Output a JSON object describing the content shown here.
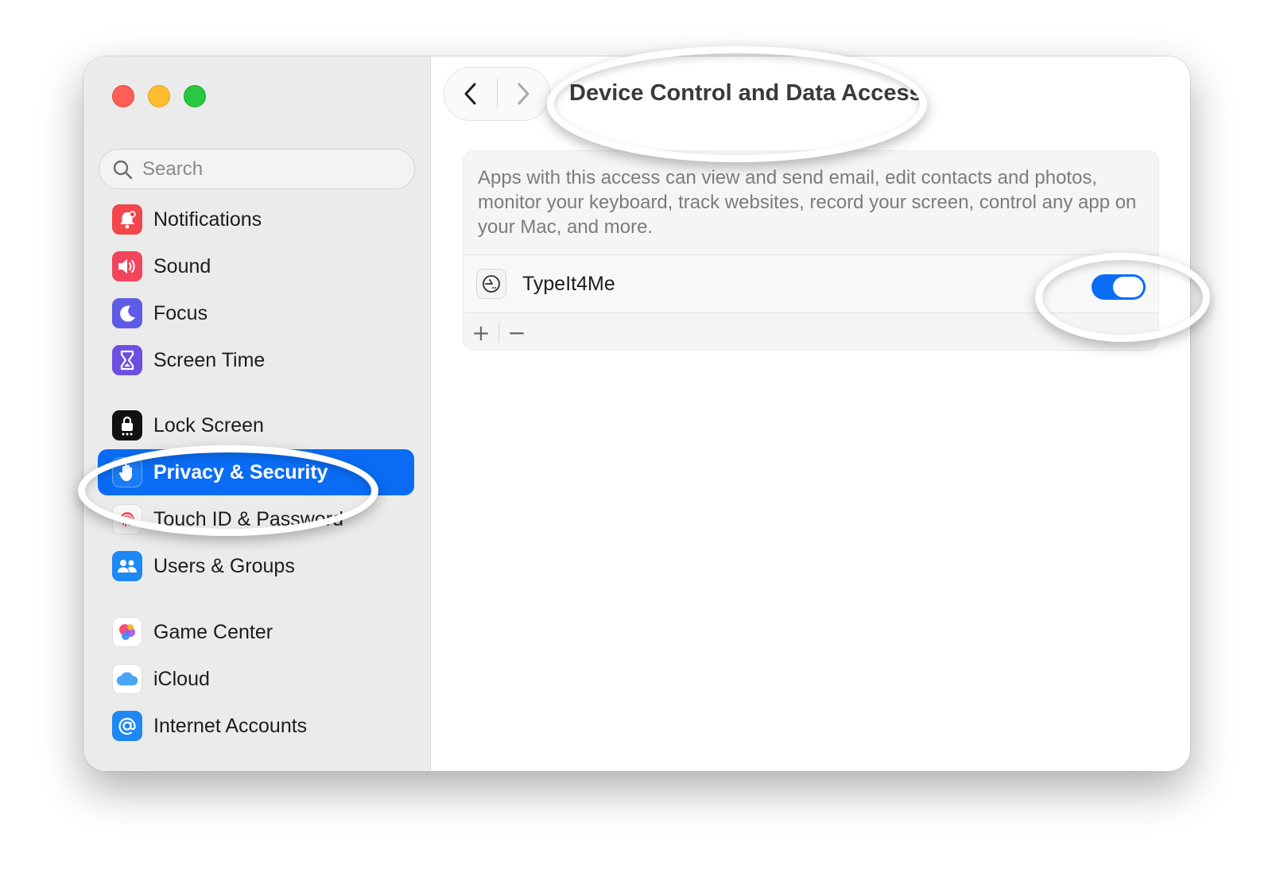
{
  "sidebar": {
    "search": {
      "placeholder": "Search"
    },
    "items": [
      {
        "label": "Notifications",
        "icon": "bell-icon",
        "color": "#f2464b"
      },
      {
        "label": "Sound",
        "icon": "speaker-icon",
        "color": "#f2455c"
      },
      {
        "label": "Focus",
        "icon": "moon-icon",
        "color": "#5e5ce6"
      },
      {
        "label": "Screen Time",
        "icon": "hourglass-icon",
        "color": "#6d4fe0"
      },
      {
        "label": "Lock Screen",
        "icon": "lock-icon",
        "color": "#111111"
      },
      {
        "label": "Privacy & Security",
        "icon": "hand-icon",
        "color": "#1b7cf5",
        "selected": true
      },
      {
        "label": "Touch ID & Password",
        "icon": "fingerprint-icon",
        "color": "#f7f7f7"
      },
      {
        "label": "Users & Groups",
        "icon": "users-icon",
        "color": "#1e88f5"
      },
      {
        "label": "Game Center",
        "icon": "game-center-icon",
        "color": "#ffffff"
      },
      {
        "label": "iCloud",
        "icon": "cloud-icon",
        "color": "#ffffff"
      },
      {
        "label": "Internet Accounts",
        "icon": "at-icon",
        "color": "#1e88f5"
      }
    ]
  },
  "main": {
    "title": "Device Control and Data Access",
    "description": "Apps with this access can view and send email, edit contacts and photos, monitor your keyboard, track websites, record your screen, control any app on your Mac, and more.",
    "apps": [
      {
        "name": "TypeIt4Me",
        "icon": "typeit4me-icon",
        "enabled": true
      }
    ],
    "add_label": "+",
    "remove_label": "−"
  },
  "colors": {
    "accent": "#0a6cf5"
  }
}
